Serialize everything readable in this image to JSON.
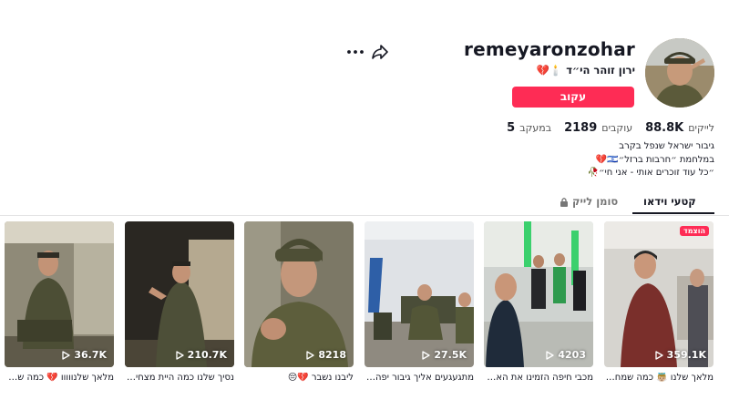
{
  "profile": {
    "username": "remeyaronzohar",
    "display_name": "ירון זוהר הי״ד 🕯️💔",
    "follow_label": "עקוב"
  },
  "stats": [
    {
      "value": "5",
      "label": "במעקב"
    },
    {
      "value": "2189",
      "label": "עוקבים"
    },
    {
      "value": "88.8K",
      "label": "לייקים"
    }
  ],
  "bio": [
    "גיבור ישראל שנפל בקרב",
    "במלחמת ״חרבות ברזל״🇮🇱💔",
    "״כל עוד זוכרים אותי - אני חי״🥀"
  ],
  "tabs": {
    "videos": "קטעי וידאו",
    "liked": "סומן לייק"
  },
  "videos": [
    {
      "views": "359.1K",
      "caption": "מלאך שלנו 👼🏼 כמה שמחת...",
      "pinned_label": "הוצמד"
    },
    {
      "views": "4203",
      "caption": "מכבי חיפה הזמינו את האח..."
    },
    {
      "views": "27.5K",
      "caption": "מתגעגעים אליך גיבור יפה ..."
    },
    {
      "views": "8218",
      "caption": "ליבנו נשבר 💔😔"
    },
    {
      "views": "210.7K",
      "caption": "נסיך שלנו כמה היית מצחיק..."
    },
    {
      "views": "36.7K",
      "caption": "מלאך שלנווווו 💔 כמה שמ..."
    }
  ],
  "colors": {
    "accent": "#fe2c55",
    "text": "#161823"
  }
}
